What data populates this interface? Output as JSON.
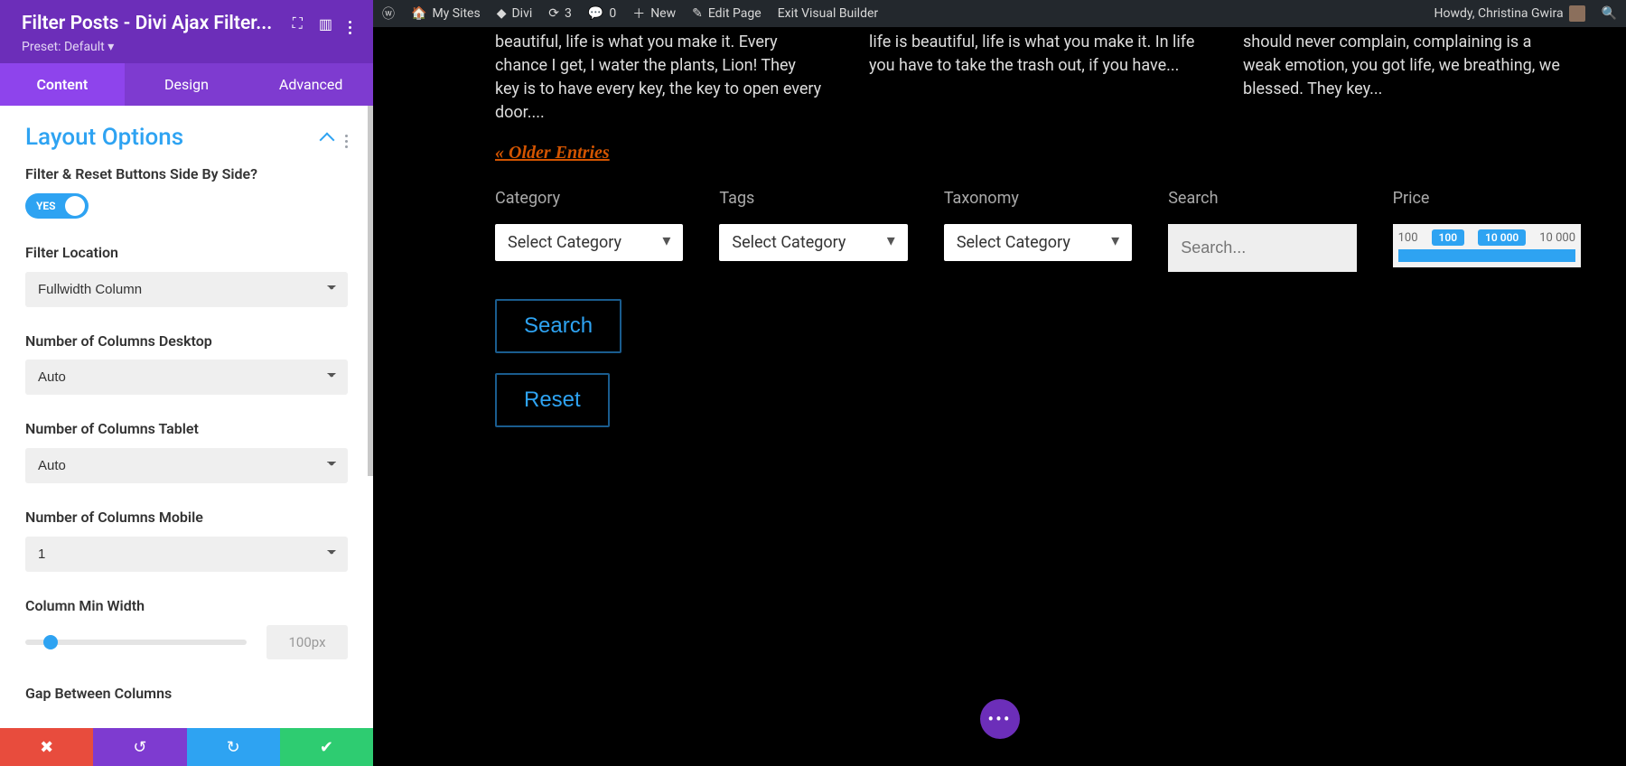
{
  "panel": {
    "title": "Filter Posts - Divi Ajax Filter...",
    "preset_label": "Preset: Default ▾",
    "tabs": {
      "content": "Content",
      "design": "Design",
      "advanced": "Advanced"
    },
    "section_title": "Layout Options",
    "fields": {
      "side_by_side_label": "Filter & Reset Buttons Side By Side?",
      "side_by_side_value": "YES",
      "filter_location_label": "Filter Location",
      "filter_location_value": "Fullwidth Column",
      "cols_desktop_label": "Number of Columns Desktop",
      "cols_desktop_value": "Auto",
      "cols_tablet_label": "Number of Columns Tablet",
      "cols_tablet_value": "Auto",
      "cols_mobile_label": "Number of Columns Mobile",
      "cols_mobile_value": "1",
      "col_min_width_label": "Column Min Width",
      "col_min_width_value": "100px",
      "gap_label": "Gap Between Columns"
    }
  },
  "wpbar": {
    "mysites": "My Sites",
    "divi": "Divi",
    "updates": "3",
    "comments": "0",
    "new": "New",
    "edit": "Edit Page",
    "exit": "Exit Visual Builder",
    "howdy": "Howdy, Christina Gwira"
  },
  "posts": {
    "a": "beautiful, life is what you make it. Every chance I get, I water the plants, Lion! They key is to have every key, the key to open every door....",
    "b": "life is beautiful, life is what you make it. In life you have to take the trash out, if you have...",
    "c": "should never complain, complaining is a weak emotion, you got life, we breathing, we blessed. They key..."
  },
  "older": "« Older Entries",
  "filters": {
    "category_label": "Category",
    "tags_label": "Tags",
    "taxonomy_label": "Taxonomy",
    "search_label": "Search",
    "price_label": "Price",
    "select_cat": "Select Category",
    "search_placeholder": "Search...",
    "price": {
      "min": "100",
      "low": "100",
      "high": "10 000",
      "max": "10 000"
    }
  },
  "buttons": {
    "search": "Search",
    "reset": "Reset"
  }
}
